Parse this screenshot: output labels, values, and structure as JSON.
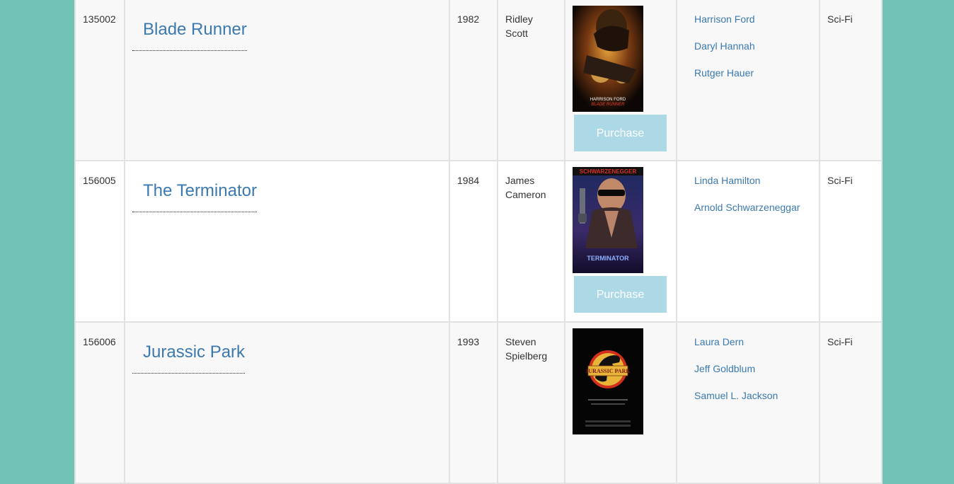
{
  "movies": [
    {
      "id": "135002",
      "title": "Blade Runner",
      "year": "1982",
      "director": [
        "Ridley",
        "Scott"
      ],
      "poster_icon": "blade-runner-poster",
      "poster_caption": "HARRISON FORD",
      "poster_subtitle": "BLADE RUNNER",
      "purchase_label": "Purchase",
      "cast": [
        "Harrison Ford",
        "Daryl Hannah",
        "Rutger Hauer"
      ],
      "genre": "Sci-Fi"
    },
    {
      "id": "156005",
      "title": "The Terminator",
      "year": "1984",
      "director": [
        "James",
        "Cameron"
      ],
      "poster_icon": "terminator-poster",
      "poster_caption": "SCHWARZENEGGER",
      "poster_subtitle": "TERMINATOR",
      "purchase_label": "Purchase",
      "cast": [
        "Linda Hamilton",
        "Arnold Schwarzeneggar"
      ],
      "genre": "Sci-Fi"
    },
    {
      "id": "156006",
      "title": "Jurassic Park",
      "year": "1993",
      "director": [
        "Steven",
        "Spielberg"
      ],
      "poster_icon": "jurassic-park-poster",
      "poster_caption": "JURASSIC PARK",
      "cast": [
        "Laura Dern",
        "Jeff Goldblum",
        "Samuel L. Jackson"
      ],
      "genre": "Sci-Fi"
    }
  ],
  "colors": {
    "background": "#72c1b5",
    "link": "#3b79b0",
    "purchase_button": "#add8e6"
  }
}
